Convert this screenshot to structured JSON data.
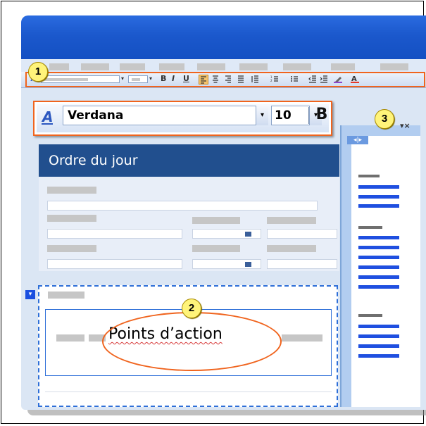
{
  "zoomed_toolbar": {
    "font_name": "Verdana",
    "font_size": "10",
    "bold_label": "B",
    "dropdown_glyph": "▾",
    "font_icon": "styles-icon"
  },
  "form": {
    "header_title": "Ordre du jour"
  },
  "rich_text": {
    "content": "Points d’action"
  },
  "callouts": {
    "one": "1",
    "two": "2",
    "three": "3"
  },
  "taskpane": {
    "controls": "▾×",
    "nav": "◂|▸"
  },
  "toolbar": {
    "bold": "B",
    "italic": "I",
    "underline": "U"
  },
  "colors": {
    "highlight": "#f0641e",
    "callout": "#fff47a",
    "header": "#214f8e",
    "accent_blue": "#1f4fe0"
  }
}
